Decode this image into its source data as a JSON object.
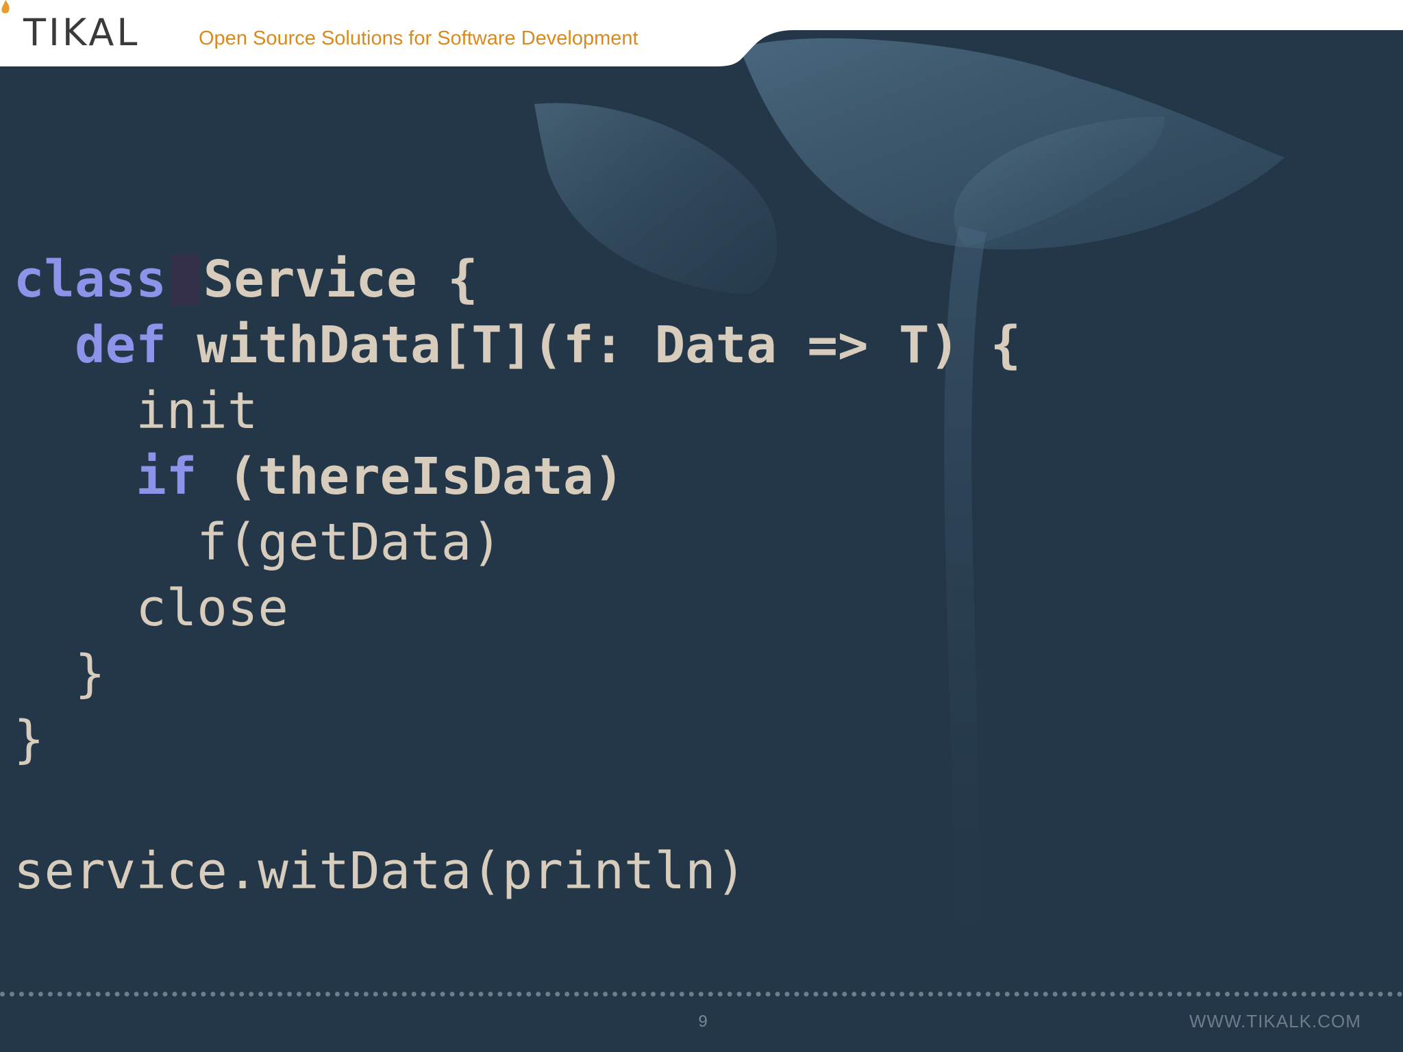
{
  "header": {
    "logo_text": "TIKAL",
    "tagline": "Open Source Solutions for Software Development"
  },
  "code": {
    "line1_kw": "class",
    "line1_rest": "Service {",
    "line2_indent": "  ",
    "line2_kw": "def",
    "line2_rest": " withData[T](f: Data => T) {",
    "line3": "    init",
    "line4_indent": "    ",
    "line4_kw": "if",
    "line4_rest": " (thereIsData)",
    "line5": "      f(getData)",
    "line6": "    close",
    "line7": "  }",
    "line8": "}",
    "line9": "",
    "line10": "service.witData(println)"
  },
  "footer": {
    "page_number": "9",
    "website": "WWW.TIKALK.COM"
  },
  "colors": {
    "background": "#243749",
    "keyword": "#8c93e8",
    "code_text": "#d8ccbc",
    "tagline": "#d98a1e"
  }
}
